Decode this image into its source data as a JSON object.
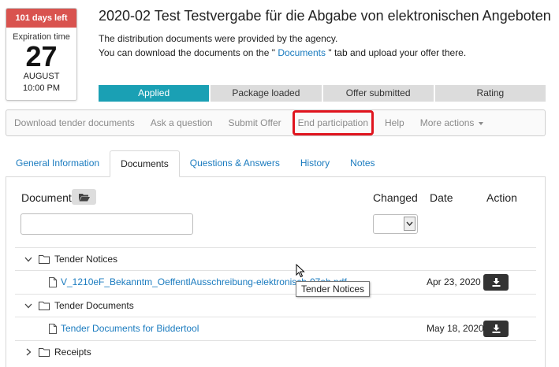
{
  "expiration": {
    "days_left": "101 days left",
    "label": "Expiration time",
    "day": "27",
    "month": "AUGUST",
    "time": "10:00 PM"
  },
  "header": {
    "title": "2020-02 Test Testvergabe für die Abgabe von elektronischen Angeboten",
    "line1": "The distribution documents were provided by the agency.",
    "line2_before": "You can download the documents on the \" ",
    "line2_link": "Documents",
    "line2_after": " \" tab and upload your offer there."
  },
  "steps": [
    "Applied",
    "Package loaded",
    "Offer submitted",
    "Rating"
  ],
  "actions": {
    "download": "Download tender documents",
    "ask": "Ask a question",
    "submit": "Submit Offer",
    "end": "End participation",
    "help": "Help",
    "more": "More actions"
  },
  "tabs": [
    "General Information",
    "Documents",
    "Questions & Answers",
    "History",
    "Notes"
  ],
  "table": {
    "col_document": "Document",
    "col_changed": "Changed",
    "col_date": "Date",
    "col_action": "Action"
  },
  "rows": {
    "folder1": "Tender Notices",
    "file1": "V_1210eF_Bekanntm_OeffentlAusschreibung-elektronisch-07ab.pdf",
    "file1_date": "Apr 23, 2020",
    "folder2": "Tender Documents",
    "file2": "Tender Documents for Biddertool",
    "file2_date": "May 18, 2020",
    "folder3": "Receipts"
  },
  "tooltip": "Tender Notices",
  "colors": {
    "days_badge": "#d9534f",
    "active_step": "#1aa0b4",
    "link": "#1a7bbf",
    "highlight_border": "#e0141e"
  },
  "icons": [
    "folder-open-icon",
    "chevron-down-icon",
    "chevron-right-icon",
    "folder-icon",
    "file-icon",
    "download-icon",
    "select-arrow-icon",
    "mouse-cursor-icon"
  ]
}
